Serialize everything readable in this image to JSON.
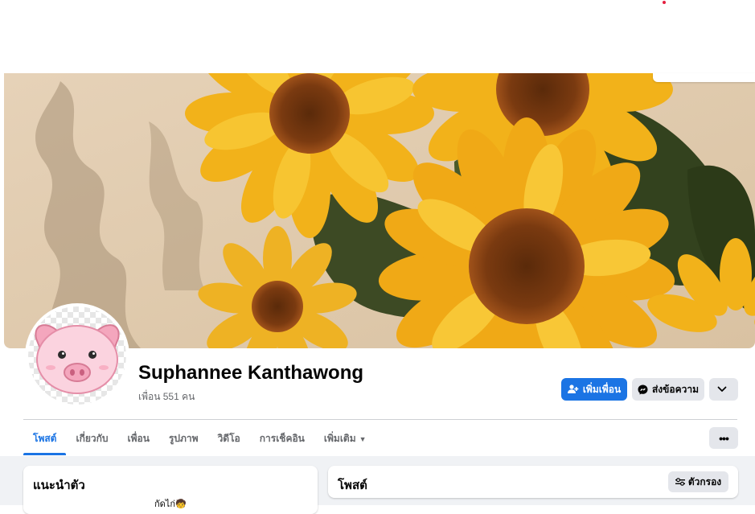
{
  "profile": {
    "name": "Suphannee Kanthawong",
    "friends_count": "เพื่อน 551 คน"
  },
  "actions": {
    "add_friend_label": "เพิ่มเพื่อน",
    "message_label": "ส่งข้อความ"
  },
  "tabs": [
    {
      "label": "โพสต์",
      "active": true
    },
    {
      "label": "เกี่ยวกับ",
      "active": false
    },
    {
      "label": "เพื่อน",
      "active": false
    },
    {
      "label": "รูปภาพ",
      "active": false
    },
    {
      "label": "วิดีโอ",
      "active": false
    },
    {
      "label": "การเช็คอิน",
      "active": false
    },
    {
      "label": "เพิ่มเติม",
      "active": false
    }
  ],
  "tab_more_caret": "▼",
  "tab_overflow_label": "•••",
  "intro": {
    "title": "แนะนำตัว",
    "bio": "กัดไก่🧒"
  },
  "posts": {
    "title": "โพสต์",
    "filter_label": "ตัวกรอง"
  },
  "colors": {
    "accent": "#1b74e4",
    "background": "#f0f2f5",
    "button_gray": "#e4e6eb",
    "text_secondary": "#65676b",
    "notification_dot": "#e41e3f"
  },
  "icons": {
    "add_friend": "person-add-icon",
    "message": "messenger-icon",
    "more": "chevron-down-icon",
    "filter": "sliders-icon",
    "cover": "sunflower-photo",
    "avatar": "pig-face-sticker"
  }
}
